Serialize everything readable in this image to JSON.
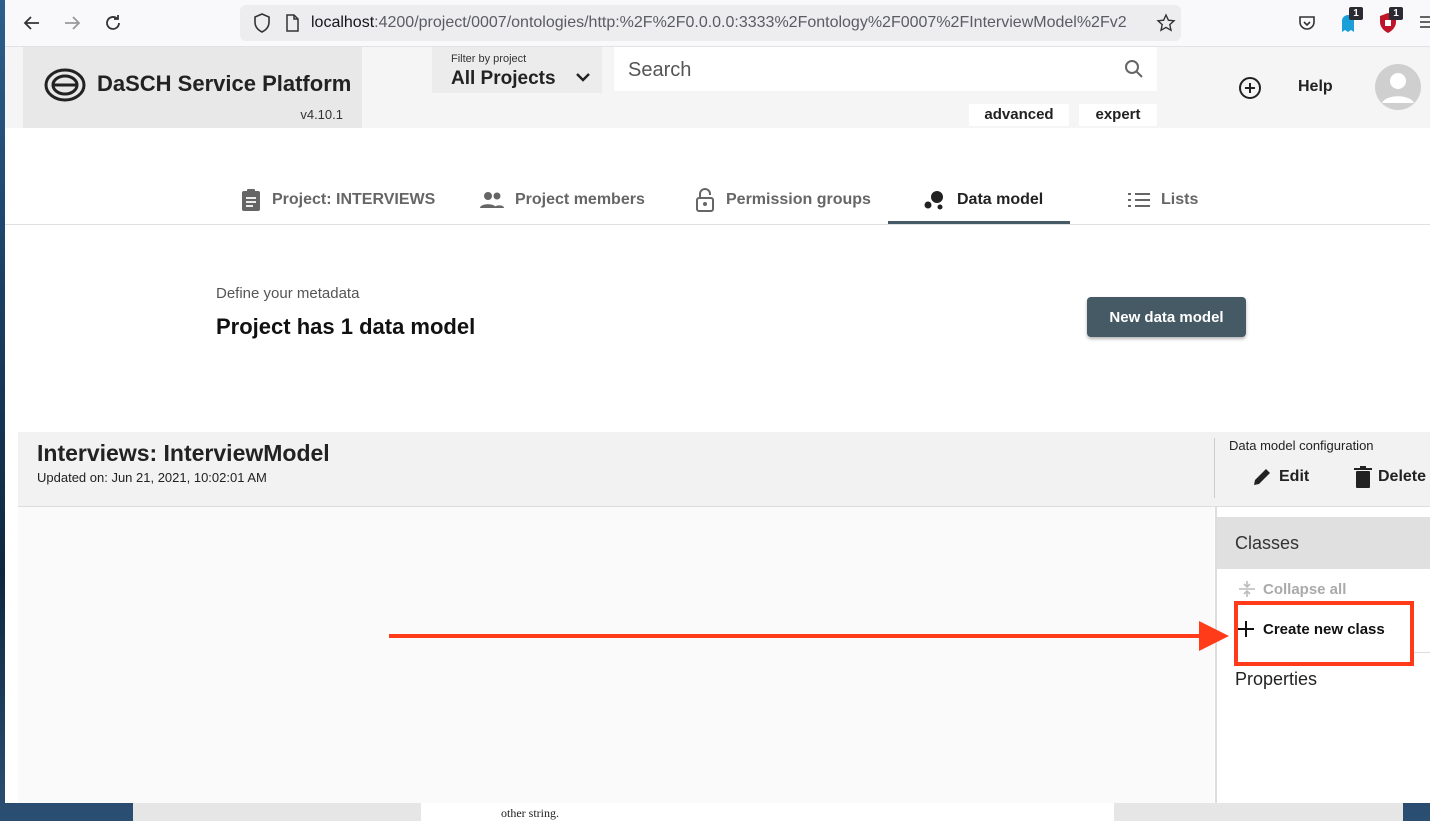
{
  "browser": {
    "url_host": "localhost",
    "url_path": ":4200/project/0007/ontologies/http:%2F%2F0.0.0.0:3333%2Fontology%2F0007%2FInterviewModel%2Fv2",
    "extension_badges": [
      "1",
      "1"
    ]
  },
  "header": {
    "brand": "DaSCH Service Platform",
    "version": "v4.10.1",
    "filter_label": "Filter by project",
    "filter_value": "All Projects",
    "search_placeholder": "Search",
    "advanced_label": "advanced",
    "expert_label": "expert",
    "help_label": "Help"
  },
  "tabs": [
    {
      "label": "Project: INTERVIEWS",
      "icon": "clipboard-icon"
    },
    {
      "label": "Project members",
      "icon": "group-icon"
    },
    {
      "label": "Permission groups",
      "icon": "lock-icon"
    },
    {
      "label": "Data model",
      "icon": "bubble-chart-icon",
      "active": true
    },
    {
      "label": "Lists",
      "icon": "list-icon"
    }
  ],
  "data_models": {
    "subtitle": "Define your metadata",
    "title": "Project has 1 data model",
    "new_button": "New data model"
  },
  "ontology": {
    "title": "Interviews: InterviewModel",
    "updated": "Updated on: Jun 21, 2021, 10:02:01 AM",
    "config_label": "Data model configuration",
    "edit_label": "Edit",
    "delete_label": "Delete"
  },
  "side_panel": {
    "classes_label": "Classes",
    "collapse_all_label": "Collapse all",
    "create_class_label": "Create new class",
    "properties_label": "Properties"
  },
  "background_window": {
    "text": "other string."
  },
  "colors": {
    "primary": "#455a64",
    "annotation": "#ff3b1a"
  }
}
